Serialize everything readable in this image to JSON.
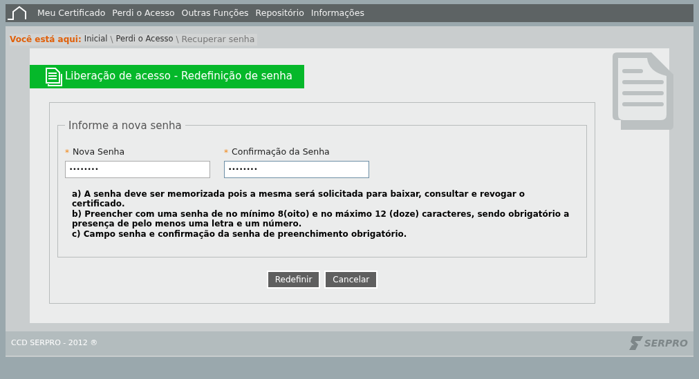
{
  "nav": {
    "items": [
      "Meu Certificado",
      "Perdi o Acesso",
      "Outras Funções",
      "Repositório",
      "Informações"
    ]
  },
  "breadcrumb": {
    "label": "Você está aqui:",
    "items": [
      {
        "text": "Inicial",
        "current": false
      },
      {
        "text": "Perdi o Acesso",
        "current": false
      },
      {
        "text": "Recuperar senha",
        "current": true
      }
    ],
    "separator": "\\"
  },
  "title": "Liberação de acesso - Redefinição de senha",
  "fieldset": {
    "legend": "Informe a nova senha",
    "fields": [
      {
        "label": "Nova Senha",
        "required_mark": "*",
        "value": "••••••••",
        "focused": false
      },
      {
        "label": "Confirmação da Senha",
        "required_mark": "*",
        "value": "••••••••",
        "focused": true
      }
    ],
    "notes": [
      "a) A senha deve ser memorizada pois a mesma será solicitada para baixar, consultar e revogar o certificado.",
      "b) Preencher com uma senha de no mínimo 8(oito) e no máximo 12 (doze) caracteres, sendo obrigatório a presença de pelo menos uma letra e um número.",
      "c) Campo senha e confirmação da senha de preenchimento obrigatório."
    ]
  },
  "buttons": [
    "Redefinir",
    "Cancelar"
  ],
  "footer": {
    "text": "CCD SERPRO - 2012 ®",
    "logo_text": "SERPRO"
  }
}
